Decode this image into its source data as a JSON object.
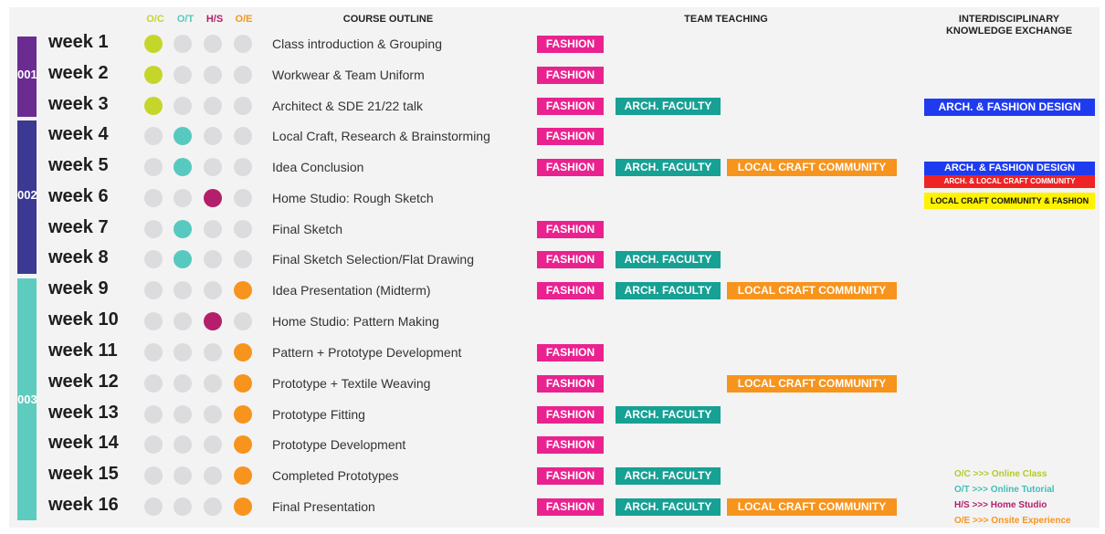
{
  "colors": {
    "oc": "#c5d62b",
    "ot": "#58c9bf",
    "hs": "#b31f6a",
    "oe": "#f7941d",
    "inactive": "#dcdcdf",
    "fashion": "#ea2290",
    "arch": "#17a094",
    "craft": "#f7941d",
    "sec1": "#6a2c91",
    "sec2": "#3b3992",
    "sec3": "#5ecbbf",
    "ide_blue": "#1f3bf0",
    "ide_red": "#ee2424",
    "ide_yellow": "#fff200"
  },
  "headers": {
    "modes": [
      "O/C",
      "O/T",
      "H/S",
      "O/E"
    ],
    "course_outline": "COURSE OUTLINE",
    "team_teaching": "TEAM TEACHING",
    "interdisciplinary_line1": "INTERDISCIPLINARY",
    "interdisciplinary_line2": "KNOWLEDGE EXCHANGE"
  },
  "sections": [
    "001",
    "002",
    "003"
  ],
  "weeks": [
    {
      "label": "week 1",
      "mode": 0,
      "desc": "Class introduction & Grouping",
      "tags": [
        "FASHION"
      ]
    },
    {
      "label": "week 2",
      "mode": 0,
      "desc": "Workwear & Team Uniform",
      "tags": [
        "FASHION"
      ]
    },
    {
      "label": "week 3",
      "mode": 0,
      "desc": "Architect & SDE 21/22 talk",
      "tags": [
        "FASHION",
        "ARCH. FACULTY"
      ]
    },
    {
      "label": "week 4",
      "mode": 1,
      "desc": "Local Craft, Research & Brainstorming",
      "tags": [
        "FASHION"
      ]
    },
    {
      "label": "week 5",
      "mode": 1,
      "desc": "Idea Conclusion",
      "tags": [
        "FASHION",
        "ARCH. FACULTY",
        "LOCAL CRAFT COMMUNITY"
      ]
    },
    {
      "label": "week 6",
      "mode": 2,
      "desc": "Home Studio: Rough Sketch",
      "tags": []
    },
    {
      "label": "week 7",
      "mode": 1,
      "desc": "Final Sketch",
      "tags": [
        "FASHION"
      ]
    },
    {
      "label": "week 8",
      "mode": 1,
      "desc": "Final Sketch Selection/Flat Drawing",
      "tags": [
        "FASHION",
        "ARCH. FACULTY"
      ]
    },
    {
      "label": "week 9",
      "mode": 3,
      "desc": "Idea Presentation (Midterm)",
      "tags": [
        "FASHION",
        "ARCH. FACULTY",
        "LOCAL CRAFT COMMUNITY"
      ]
    },
    {
      "label": "week 10",
      "mode": 2,
      "desc": "Home Studio: Pattern Making",
      "tags": []
    },
    {
      "label": "week 11",
      "mode": 3,
      "desc": "Pattern + Prototype Development",
      "tags": [
        "FASHION"
      ]
    },
    {
      "label": "week 12",
      "mode": 3,
      "desc": "Prototype + Textile Weaving",
      "tags": [
        "FASHION",
        "LOCAL CRAFT COMMUNITY"
      ]
    },
    {
      "label": "week 13",
      "mode": 3,
      "desc": "Prototype Fitting",
      "tags": [
        "FASHION",
        "ARCH. FACULTY"
      ]
    },
    {
      "label": "week 14",
      "mode": 3,
      "desc": "Prototype Development",
      "tags": [
        "FASHION"
      ]
    },
    {
      "label": "week 15",
      "mode": 3,
      "desc": "Completed Prototypes",
      "tags": [
        "FASHION",
        "ARCH. FACULTY"
      ]
    },
    {
      "label": "week 16",
      "mode": 3,
      "desc": "Final Presentation",
      "tags": [
        "FASHION",
        "ARCH. FACULTY",
        "LOCAL CRAFT COMMUNITY"
      ]
    }
  ],
  "interdisciplinary": {
    "week3": "ARCH. & FASHION DESIGN",
    "week5_a": "ARCH. & FASHION DESIGN",
    "week5_b": "ARCH. & LOCAL CRAFT COMMUNITY",
    "week6": "LOCAL CRAFT COMMUNITY & FASHION"
  },
  "legend": [
    "O/C >>> Online Class",
    "O/T >>> Online Tutorial",
    "H/S >>> Home Studio",
    "O/E >>> Onsite Experience"
  ]
}
